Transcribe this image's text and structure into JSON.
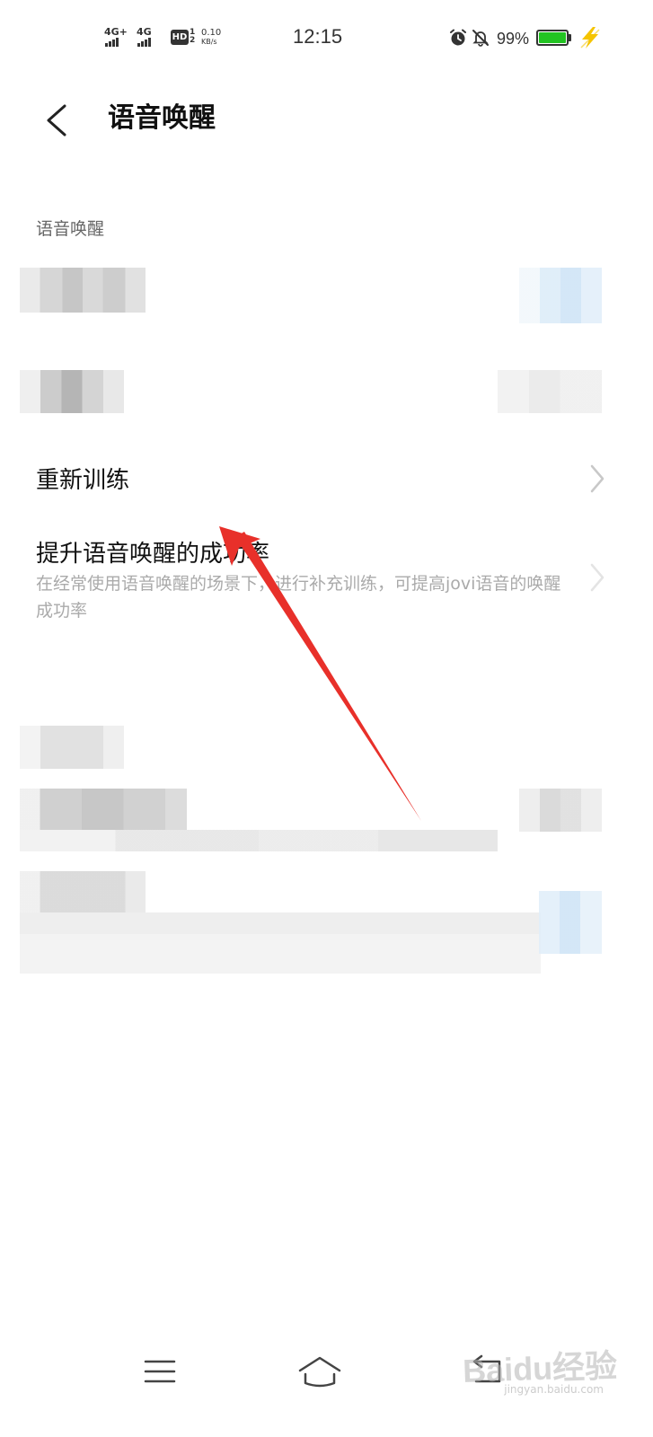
{
  "status_bar": {
    "signal_1": "4G+",
    "signal_2": "4G",
    "hd_label": "HD",
    "hd_sub_1": "1",
    "hd_sub_2": "2",
    "net_speed_value": "0.10",
    "net_speed_unit": "KB/s",
    "time": "12:15",
    "battery_percent": "99%",
    "battery_level": 0.99,
    "battery_color": "#22c322",
    "charging_color": "#f5c400"
  },
  "header": {
    "title": "语音唤醒"
  },
  "section": {
    "label": "语音唤醒"
  },
  "rows": [
    {
      "title": "重新训练",
      "icon": "chevron-right-icon"
    },
    {
      "title": "提升语音唤醒的成功率",
      "description": "在经常使用语音唤醒的场景下，进行补充训练，可提高jovi语音的唤醒成功率",
      "icon": "chevron-right-icon"
    }
  ],
  "annotation": {
    "arrow_color": "#e8302a"
  },
  "nav": {
    "menu_icon": "menu-icon",
    "home_icon": "home-icon",
    "back_icon": "back-return-icon"
  },
  "watermark": {
    "text": "Baidu经验",
    "sub": "jingyan.baidu.com"
  }
}
